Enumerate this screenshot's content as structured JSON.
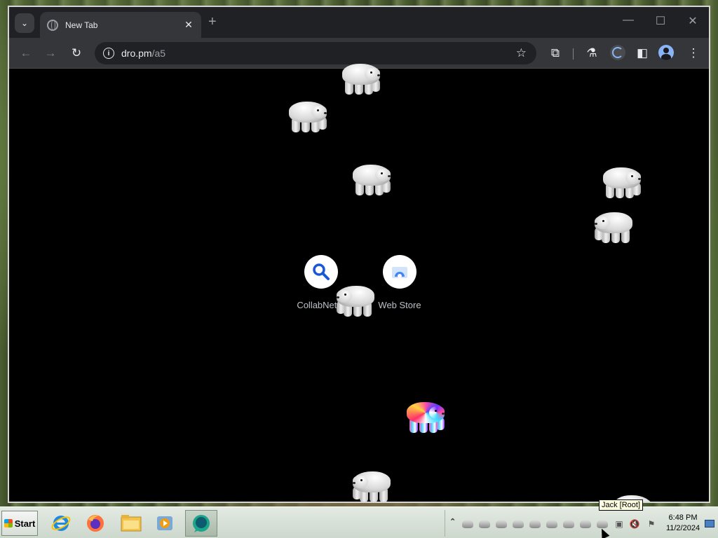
{
  "browser": {
    "tab": {
      "title": "New Tab",
      "close_glyph": "✕"
    },
    "new_tab_glyph": "+",
    "window_controls": {
      "minimize": "—",
      "maximize": "☐",
      "close": "✕"
    },
    "toolbar": {
      "back_glyph": "←",
      "forward_glyph": "→",
      "reload_glyph": "↻",
      "url_host": "dro.pm",
      "url_path": "/a5",
      "star_glyph": "☆",
      "extensions_glyph": "⧉",
      "labs_glyph": "⚗",
      "sidepanel_glyph": "◧",
      "menu_glyph": "⋮"
    }
  },
  "shortcuts": [
    {
      "label": "CollabNet S",
      "icon": "search-icon"
    },
    {
      "label": "Web Store",
      "icon": "web-store-icon"
    }
  ],
  "tooltip": "Jack [Root]",
  "taskbar": {
    "start_label": "Start",
    "apps": [
      "internet-explorer-icon",
      "firefox-icon",
      "file-explorer-icon",
      "media-player-icon",
      "chat-app-icon"
    ],
    "tray_chevron": "⌃",
    "clock_time": "6:48 PM",
    "clock_date": "11/2/2024"
  },
  "colors": {
    "browser_frame": "#202124",
    "toolbar": "#35363a",
    "page_background": "#000000",
    "taskbar": "#d5dfd5"
  }
}
